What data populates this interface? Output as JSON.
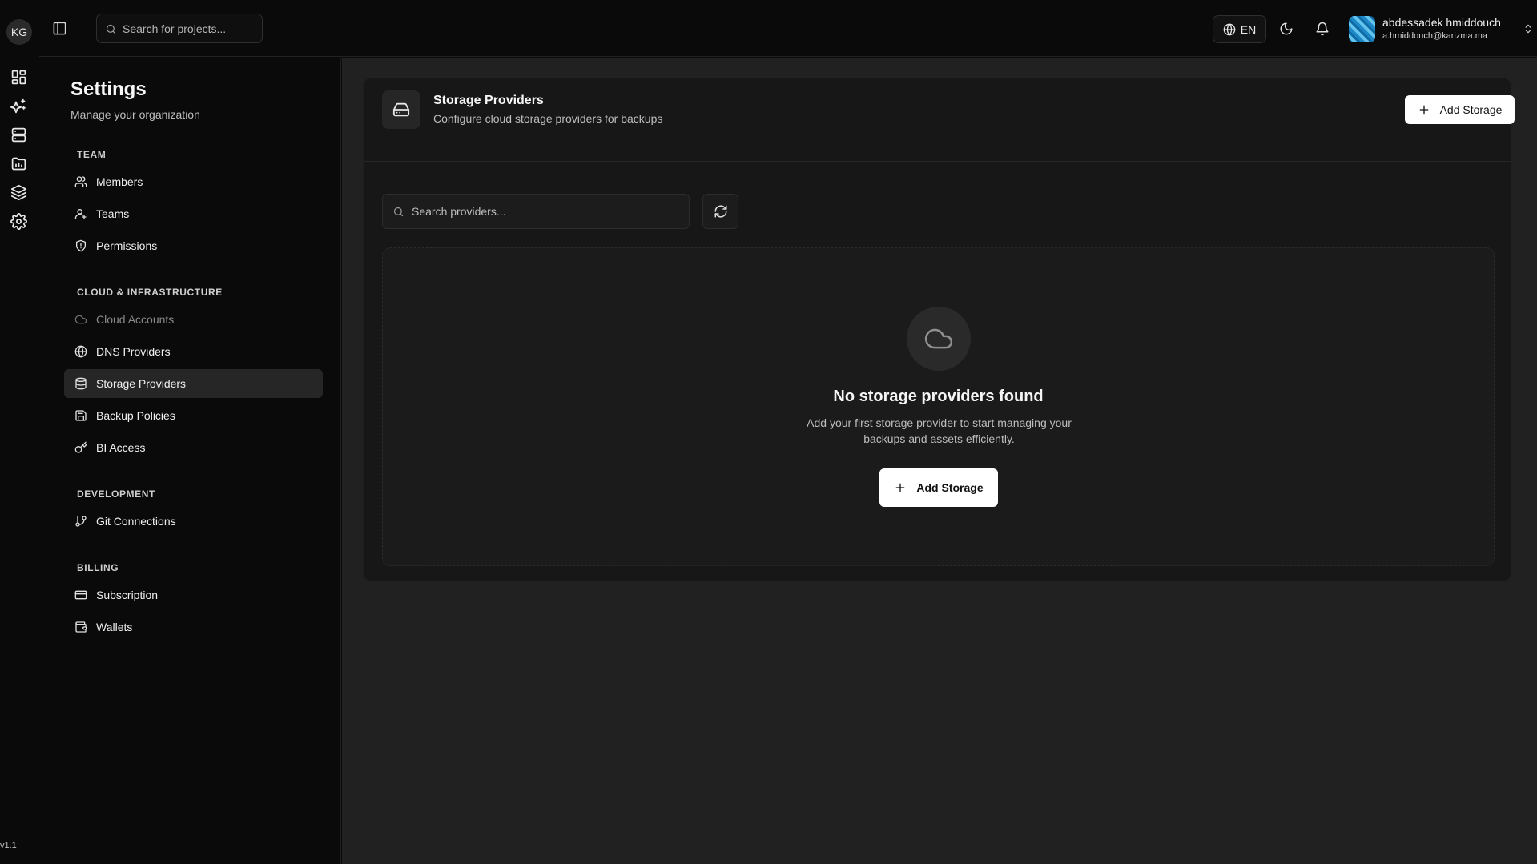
{
  "rail": {
    "logo_text": "KG",
    "icons": [
      "dashboard-icon",
      "sparkles-icon",
      "servers-icon",
      "projects-folder-icon",
      "layers-icon",
      "settings-gear-icon"
    ],
    "version": "v1.1"
  },
  "topbar": {
    "search_placeholder": "Search for projects...",
    "language": "EN",
    "user": {
      "name": "abdessadek hmiddouch",
      "email": "a.hmiddouch@karizma.ma"
    }
  },
  "settings": {
    "title": "Settings",
    "subtitle": "Manage your organization",
    "sections": [
      {
        "label": "TEAM",
        "items": [
          {
            "label": "Members",
            "icon": "users-icon"
          },
          {
            "label": "Teams",
            "icon": "user-group-icon"
          },
          {
            "label": "Permissions",
            "icon": "shield-icon"
          }
        ]
      },
      {
        "label": "CLOUD & INFRASTRUCTURE",
        "items": [
          {
            "label": "Cloud Accounts",
            "icon": "cloud-icon",
            "state": "disabled"
          },
          {
            "label": "DNS Providers",
            "icon": "globe-icon"
          },
          {
            "label": "Storage Providers",
            "icon": "database-icon",
            "state": "active"
          },
          {
            "label": "Backup Policies",
            "icon": "save-icon"
          },
          {
            "label": "BI Access",
            "icon": "key-icon"
          }
        ]
      },
      {
        "label": "DEVELOPMENT",
        "items": [
          {
            "label": "Git Connections",
            "icon": "git-branch-icon"
          }
        ]
      },
      {
        "label": "BILLING",
        "items": [
          {
            "label": "Subscription",
            "icon": "credit-card-icon"
          },
          {
            "label": "Wallets",
            "icon": "wallet-icon"
          }
        ]
      }
    ]
  },
  "main": {
    "title": "Storage Providers",
    "subtitle": "Configure cloud storage providers for backups",
    "add_button": "Add Storage",
    "search_placeholder": "Search providers...",
    "empty": {
      "title": "No storage providers found",
      "description": "Add your first storage provider to start managing your backups and assets efficiently.",
      "button": "Add Storage"
    }
  },
  "colors": {
    "background": "#0a0a0a",
    "main_background": "#212121",
    "card_background": "#171717",
    "active_item": "#262626",
    "primary_button": "#ffffff"
  }
}
